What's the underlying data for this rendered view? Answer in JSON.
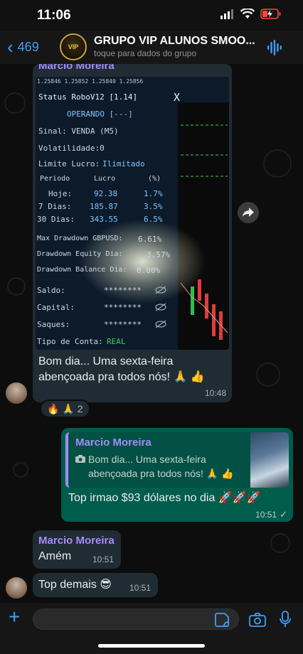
{
  "status_bar": {
    "time": "11:06"
  },
  "header": {
    "back_count": "469",
    "group_title": "GRUPO VIP ALUNOS SMOO...",
    "group_subtitle": "toque para dados do grupo",
    "avatar_text": "VIP"
  },
  "messages": {
    "image_message": {
      "sender": "Marcio Moreira",
      "photo_lines": {
        "ticker": "1.25846 1.25852 1.25840 1.25856",
        "status": "Status RoboV12 [1.14]",
        "close": "X",
        "operando": "OPERANDO [---]",
        "sinal": "Sinal: VENDA (M5)",
        "volatilidade": "Volatilidade:0",
        "limite_label": "Limite Lucro:",
        "limite_value": "Ilimitado",
        "col_periodo": "Periodo",
        "col_lucro": "Lucro",
        "col_pct": "(%)",
        "row_hoje": "Hoje:",
        "row_hoje_lucro": "92.38",
        "row_hoje_pct": "1.7%",
        "row_7": "7 Dias:",
        "row_7_lucro": "185.87",
        "row_7_pct": "3.5%",
        "row_30": "30 Dias:",
        "row_30_lucro": "343.55",
        "row_30_pct": "6.5%",
        "max_dd": "Max Drawdown GBPUSD:",
        "max_dd_v": "6.61%",
        "dd_equity": "Drawdown Equity Dia:",
        "dd_equity_v": "3.57%",
        "dd_balance": "Drawdown Balance Dia:",
        "dd_balance_v": "0.00%",
        "saldo": "Saldo:",
        "capital": "Capital:",
        "saques": "Saques:",
        "masked": "********",
        "tipo": "Tipo de Conta:",
        "tipo_v": "REAL"
      },
      "caption": "Bom dia... Uma sexta-feira abençoada pra todos nós! 🙏 👍",
      "time": "10:48",
      "reactions": "🔥 🙏",
      "reaction_count": "2"
    },
    "reply_message": {
      "quoted_sender": "Marcio Moreira",
      "quoted_text": "Bom dia... Uma sexta-feira abençoada pra todos nós! 🙏 👍",
      "text": "Top irmao $93 dólares no dia 🚀🚀🚀",
      "time": "10:51",
      "status_tick": "✓"
    },
    "amem_message": {
      "sender": "Marcio Moreira",
      "text": "Amém",
      "time": "10:51"
    },
    "top_message": {
      "text": "Top demais 😎",
      "time": "10:51"
    }
  },
  "colors": {
    "accent_blue": "#3aa0ff",
    "incoming_bubble": "#202c33",
    "outgoing_bubble": "#005c4b",
    "sender_name": "#a78bfa"
  }
}
